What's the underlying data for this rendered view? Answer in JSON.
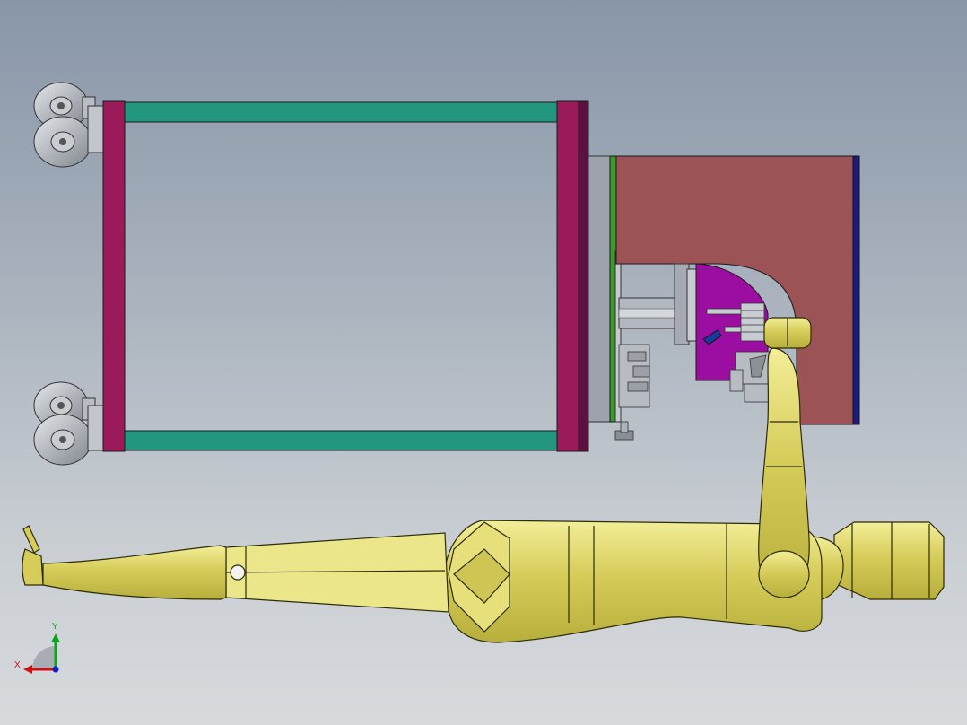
{
  "view": {
    "triad": {
      "x_label": "X",
      "y_label": "Y"
    }
  },
  "colors": {
    "frame_rail": "#22967f",
    "frame_post": "#9a1a5a",
    "enclosure": "#9b5355",
    "gripper_plate": "#9c0ea2",
    "robot_body": "#d8d060",
    "robot_edge": "#2b2b08",
    "mount_plate": "#9da2ad",
    "caster_wheel": "#9aa0a6",
    "axis_x": "#d01010",
    "axis_y": "#10a020",
    "axis_z": "#1020c0"
  },
  "icons": {
    "triad": "coordinate-triad-icon",
    "caster": "caster-wheel-icon"
  }
}
